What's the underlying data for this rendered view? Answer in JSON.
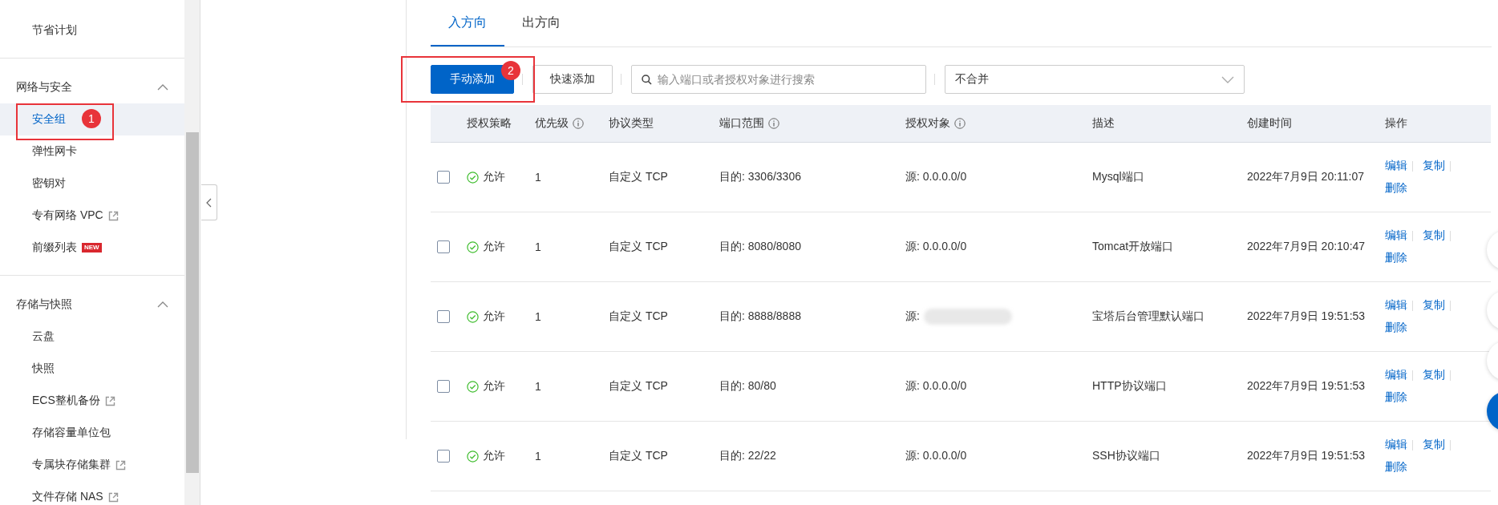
{
  "sidebar": {
    "sections": [
      {
        "items": [
          {
            "label": "节省计划",
            "selected": false,
            "external": false
          }
        ]
      },
      {
        "title": "网络与安全",
        "expanded": true,
        "items": [
          {
            "label": "安全组",
            "selected": true,
            "external": false
          },
          {
            "label": "弹性网卡",
            "selected": false,
            "external": false
          },
          {
            "label": "密钥对",
            "selected": false,
            "external": false
          },
          {
            "label": "专有网络 VPC",
            "selected": false,
            "external": true
          },
          {
            "label": "前缀列表",
            "selected": false,
            "external": false,
            "badge": "NEW"
          }
        ]
      },
      {
        "title": "存储与快照",
        "expanded": true,
        "items": [
          {
            "label": "云盘",
            "selected": false,
            "external": false
          },
          {
            "label": "快照",
            "selected": false,
            "external": false
          },
          {
            "label": "ECS整机备份",
            "selected": false,
            "external": true
          },
          {
            "label": "存储容量单位包",
            "selected": false,
            "external": false
          },
          {
            "label": "专属块存储集群",
            "selected": false,
            "external": true
          },
          {
            "label": "文件存储 NAS",
            "selected": false,
            "external": true
          }
        ]
      }
    ]
  },
  "tabs": [
    {
      "label": "入方向",
      "selected": true
    },
    {
      "label": "出方向",
      "selected": false
    }
  ],
  "toolbar": {
    "buttons": [
      {
        "label": "手动添加",
        "kind": "primary"
      },
      {
        "label": "快速添加",
        "kind": "default"
      }
    ],
    "search": {
      "placeholder": "输入端口或者授权对象进行搜索"
    },
    "merge_select": {
      "value": "不合并"
    }
  },
  "table": {
    "columns": [
      {
        "label": "授权策略",
        "info": false
      },
      {
        "label": "优先级",
        "info": true
      },
      {
        "label": "协议类型",
        "info": false
      },
      {
        "label": "端口范围",
        "info": true
      },
      {
        "label": "授权对象",
        "info": true
      },
      {
        "label": "描述",
        "info": false
      },
      {
        "label": "创建时间",
        "info": false
      },
      {
        "label": "操作",
        "info": false
      }
    ],
    "rows": [
      {
        "checked": false,
        "policy": "允许",
        "priority": "1",
        "protocol": "自定义 TCP",
        "port": "目的: 3306/3306",
        "source": "源: 0.0.0.0/0",
        "redacted": false,
        "description": "Mysql端口",
        "created": "2022年7月9日 20:11:07",
        "actions": [
          "编辑",
          "复制",
          "删除"
        ]
      },
      {
        "checked": false,
        "policy": "允许",
        "priority": "1",
        "protocol": "自定义 TCP",
        "port": "目的: 8080/8080",
        "source": "源: 0.0.0.0/0",
        "redacted": false,
        "description": "Tomcat开放端口",
        "created": "2022年7月9日 20:10:47",
        "actions": [
          "编辑",
          "复制",
          "删除"
        ]
      },
      {
        "checked": false,
        "policy": "允许",
        "priority": "1",
        "protocol": "自定义 TCP",
        "port": "目的: 8888/8888",
        "source": "源:",
        "redacted": true,
        "description": "宝塔后台管理默认端口",
        "created": "2022年7月9日 19:51:53",
        "actions": [
          "编辑",
          "复制",
          "删除"
        ]
      },
      {
        "checked": false,
        "policy": "允许",
        "priority": "1",
        "protocol": "自定义 TCP",
        "port": "目的: 80/80",
        "source": "源: 0.0.0.0/0",
        "redacted": false,
        "description": "HTTP协议端口",
        "created": "2022年7月9日 19:51:53",
        "actions": [
          "编辑",
          "复制",
          "删除"
        ]
      },
      {
        "checked": false,
        "policy": "允许",
        "priority": "1",
        "protocol": "自定义 TCP",
        "port": "目的: 22/22",
        "source": "源: 0.0.0.0/0",
        "redacted": false,
        "description": "SSH协议端口",
        "created": "2022年7月9日 19:51:53",
        "actions": [
          "编辑",
          "复制",
          "删除"
        ]
      }
    ]
  },
  "annotations": [
    {
      "label": "1"
    },
    {
      "label": "2"
    }
  ]
}
